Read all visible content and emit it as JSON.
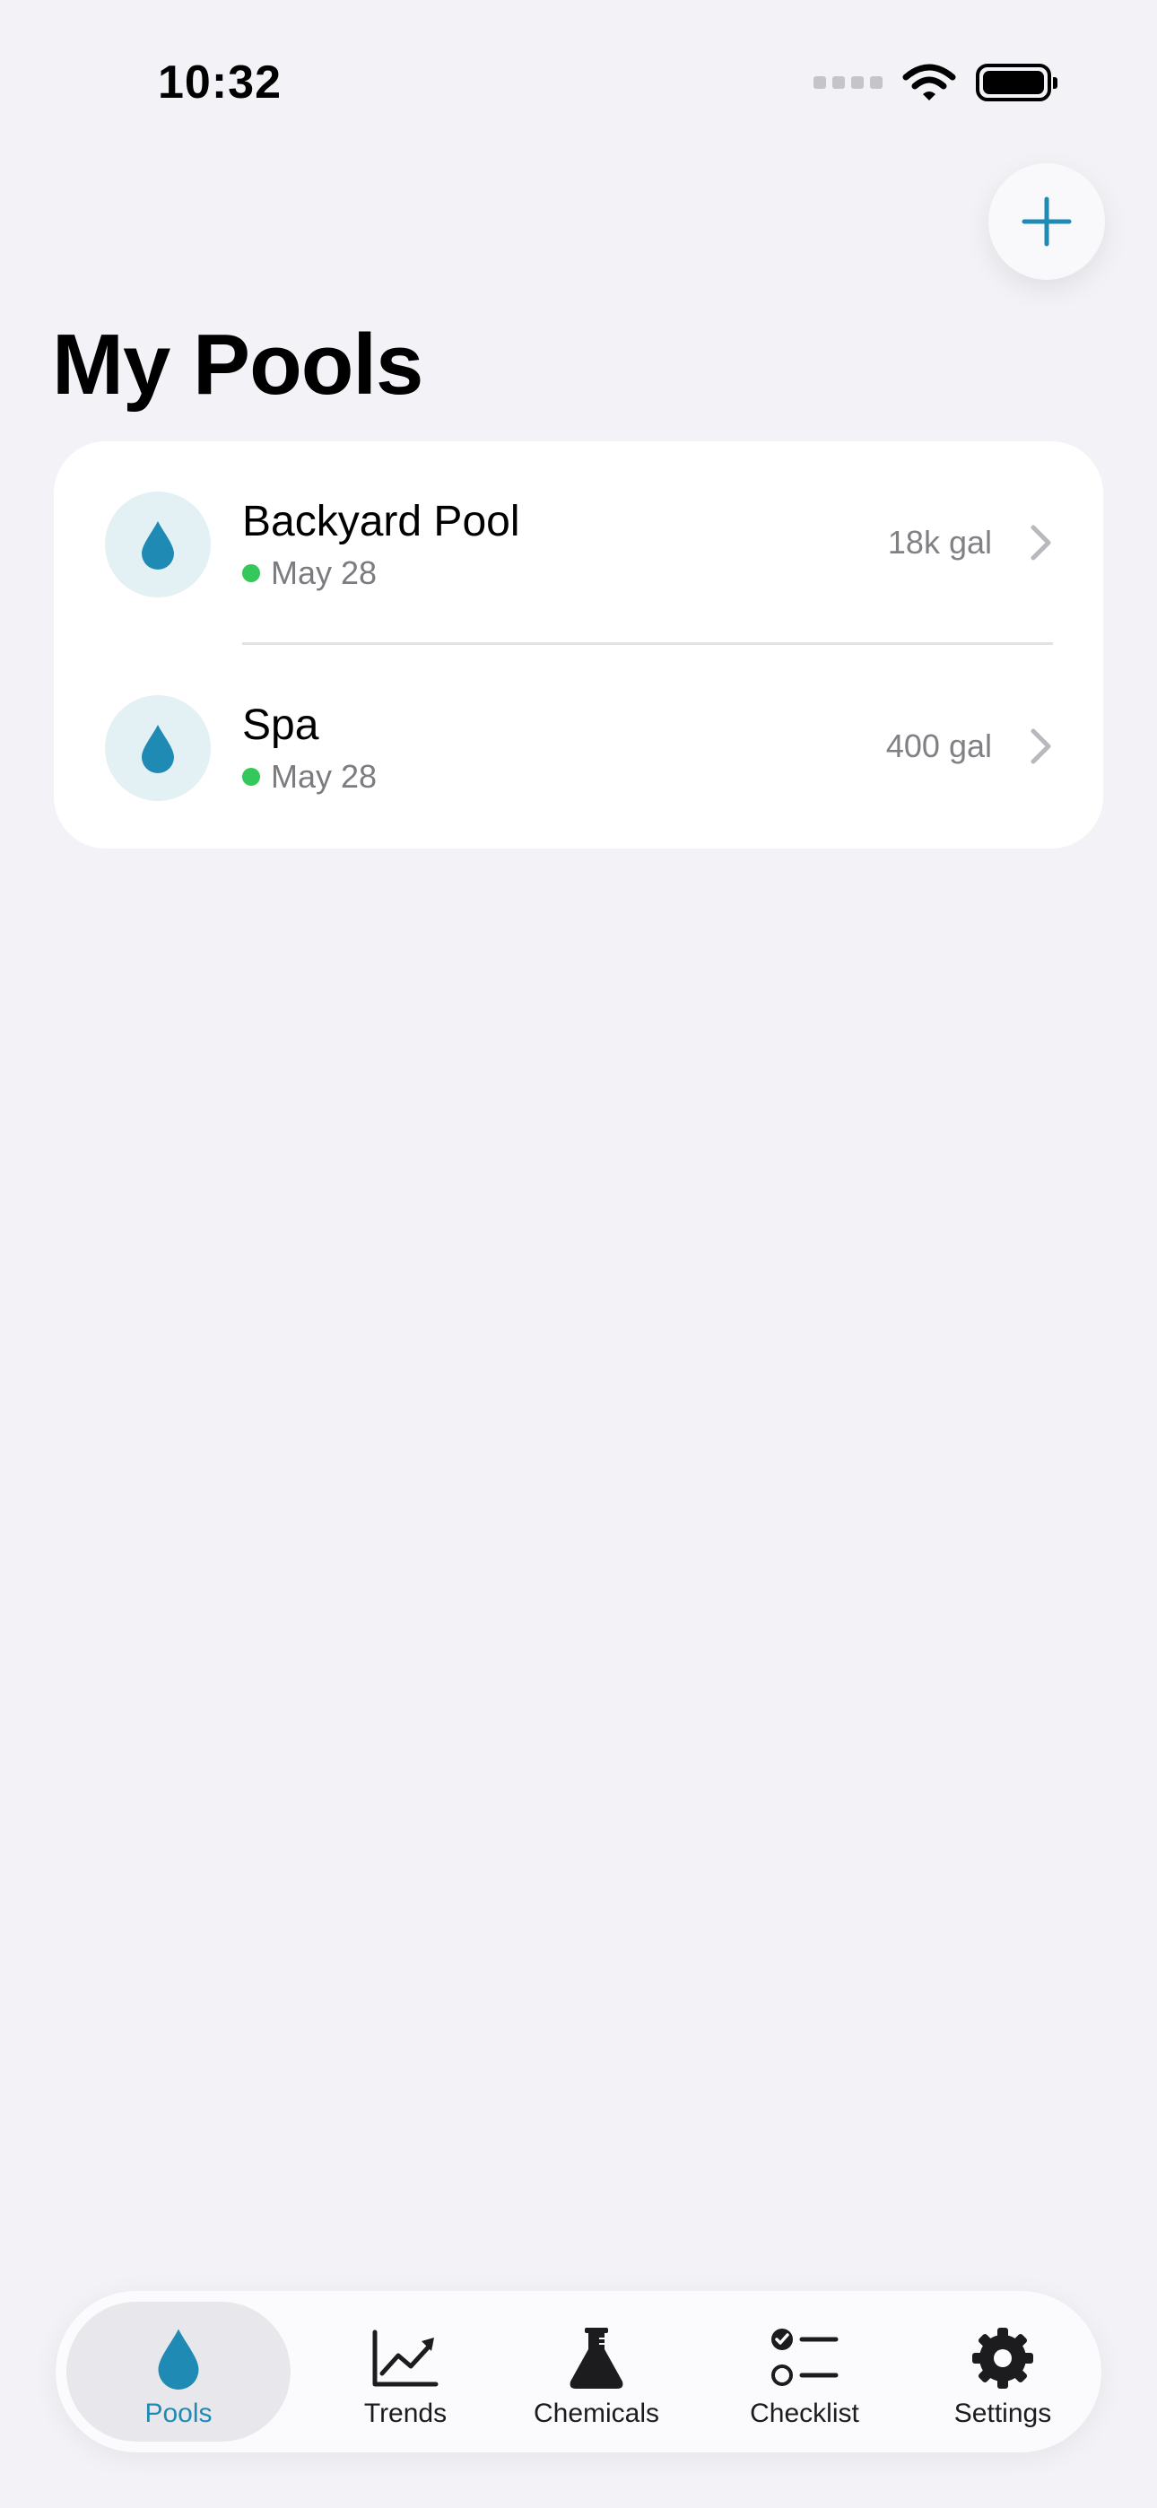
{
  "status_bar": {
    "time": "10:32"
  },
  "page": {
    "title": "My Pools"
  },
  "colors": {
    "accent": "#1f8bb4",
    "status_ok": "#34c759",
    "background": "#f2f2f7"
  },
  "pools": [
    {
      "name": "Backyard Pool",
      "date": "May 28",
      "volume": "18k gal",
      "icon": "water-drop-icon"
    },
    {
      "name": "Spa",
      "date": "May 28",
      "volume": "400 gal",
      "icon": "water-drop-icon"
    }
  ],
  "tabs": [
    {
      "label": "Pools",
      "icon": "water-drop-icon",
      "active": true
    },
    {
      "label": "Trends",
      "icon": "chart-line-icon",
      "active": false
    },
    {
      "label": "Chemicals",
      "icon": "flask-icon",
      "active": false
    },
    {
      "label": "Checklist",
      "icon": "checklist-icon",
      "active": false
    },
    {
      "label": "Settings",
      "icon": "gear-icon",
      "active": false
    }
  ]
}
